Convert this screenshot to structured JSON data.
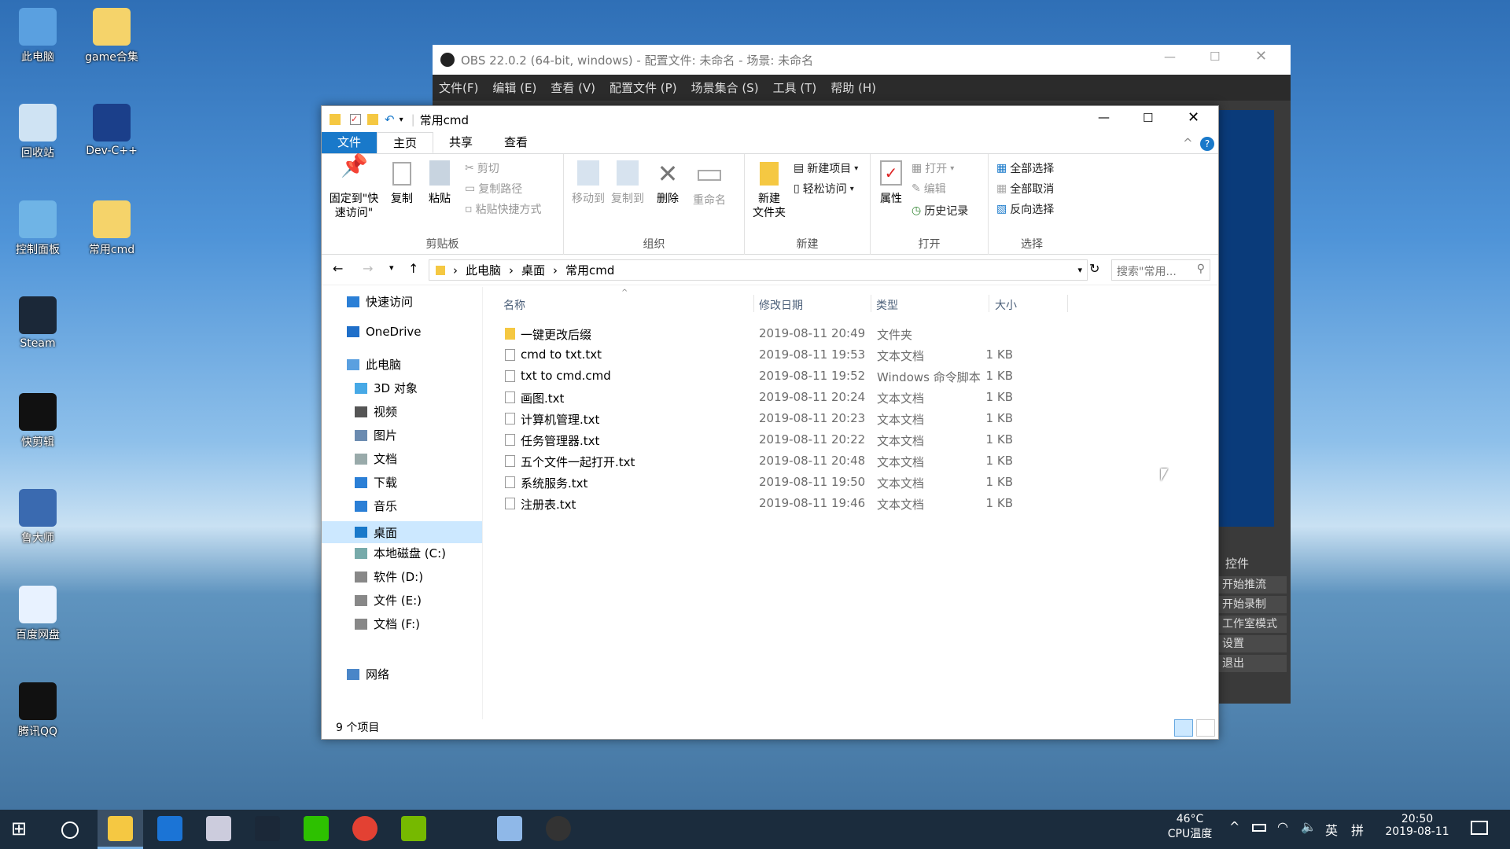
{
  "desktop": {
    "icons": [
      {
        "label": "此电脑",
        "icon": "computer-icon"
      },
      {
        "label": "game合集",
        "icon": "folder-icon"
      },
      {
        "label": "回收站",
        "icon": "recycle-bin-icon"
      },
      {
        "label": "Dev-C++",
        "icon": "devcpp-icon"
      },
      {
        "label": "控制面板",
        "icon": "control-panel-icon"
      },
      {
        "label": "常用cmd",
        "icon": "folder-icon"
      },
      {
        "label": "Steam",
        "icon": "steam-icon"
      },
      {
        "label": "快剪辑",
        "icon": "kuaijianji-icon"
      },
      {
        "label": "鲁大师",
        "icon": "ludashi-icon"
      },
      {
        "label": "百度网盘",
        "icon": "baidu-netdisk-icon"
      },
      {
        "label": "腾讯QQ",
        "icon": "qq-icon"
      }
    ]
  },
  "obs": {
    "title": "OBS 22.0.2 (64-bit, windows) - 配置文件: 未命名 - 场景: 未命名",
    "menu": [
      "文件(F)",
      "编辑 (E)",
      "查看 (V)",
      "配置文件 (P)",
      "场景集合 (S)",
      "工具 (T)",
      "帮助 (H)"
    ],
    "controls_title": "控件",
    "controls": [
      "开始推流",
      "开始录制",
      "工作室模式",
      "设置",
      "退出"
    ]
  },
  "explorer": {
    "title": "常用cmd",
    "tabs": [
      "文件",
      "主页",
      "共享",
      "查看"
    ],
    "ribbon": {
      "clipboard": {
        "name": "剪贴板",
        "pin": "固定到\"快速访问\"",
        "copy": "复制",
        "paste": "粘贴",
        "cut": "剪切",
        "copy_path": "复制路径",
        "paste_shortcut": "粘贴快捷方式"
      },
      "organize": {
        "name": "组织",
        "move_to": "移动到",
        "copy_to": "复制到",
        "delete": "删除",
        "rename": "重命名"
      },
      "new": {
        "name": "新建",
        "new_folder": "新建\n文件夹",
        "new_item": "新建项目",
        "easy_access": "轻松访问"
      },
      "open": {
        "name": "打开",
        "properties": "属性",
        "open": "打开",
        "edit": "编辑",
        "history": "历史记录"
      },
      "select": {
        "name": "选择",
        "select_all": "全部选择",
        "select_none": "全部取消",
        "invert": "反向选择"
      }
    },
    "breadcrumb": [
      "此电脑",
      "桌面",
      "常用cmd"
    ],
    "search_placeholder": "搜索\"常用...",
    "nav": {
      "quick_access": "快速访问",
      "onedrive": "OneDrive",
      "this_pc": "此电脑",
      "items": [
        "3D 对象",
        "视频",
        "图片",
        "文档",
        "下载",
        "音乐",
        "桌面",
        "本地磁盘 (C:)",
        "软件 (D:)",
        "文件 (E:)",
        "文档 (F:)"
      ],
      "network": "网络"
    },
    "columns": [
      "名称",
      "修改日期",
      "类型",
      "大小"
    ],
    "files": [
      {
        "name": "一键更改后缀",
        "date": "2019-08-11 20:49",
        "type": "文件夹",
        "size": ""
      },
      {
        "name": "cmd to txt.txt",
        "date": "2019-08-11 19:53",
        "type": "文本文档",
        "size": "1 KB"
      },
      {
        "name": "txt to cmd.cmd",
        "date": "2019-08-11 19:52",
        "type": "Windows 命令脚本",
        "size": "1 KB"
      },
      {
        "name": "画图.txt",
        "date": "2019-08-11 20:24",
        "type": "文本文档",
        "size": "1 KB"
      },
      {
        "name": "计算机管理.txt",
        "date": "2019-08-11 20:23",
        "type": "文本文档",
        "size": "1 KB"
      },
      {
        "name": "任务管理器.txt",
        "date": "2019-08-11 20:22",
        "type": "文本文档",
        "size": "1 KB"
      },
      {
        "name": "五个文件一起打开.txt",
        "date": "2019-08-11 20:48",
        "type": "文本文档",
        "size": "1 KB"
      },
      {
        "name": "系统服务.txt",
        "date": "2019-08-11 19:50",
        "type": "文本文档",
        "size": "1 KB"
      },
      {
        "name": "注册表.txt",
        "date": "2019-08-11 19:46",
        "type": "文本文档",
        "size": "1 KB"
      }
    ],
    "status": "9 个项目"
  },
  "taskbar": {
    "temp": "46°C",
    "temp_label": "CPU温度",
    "ime": "英",
    "ime2": "拼",
    "time": "20:50",
    "date": "2019-08-11"
  },
  "colors": {
    "accent": "#1979ca",
    "selected": "#cce8ff",
    "taskbar": "#1b2c3d"
  }
}
